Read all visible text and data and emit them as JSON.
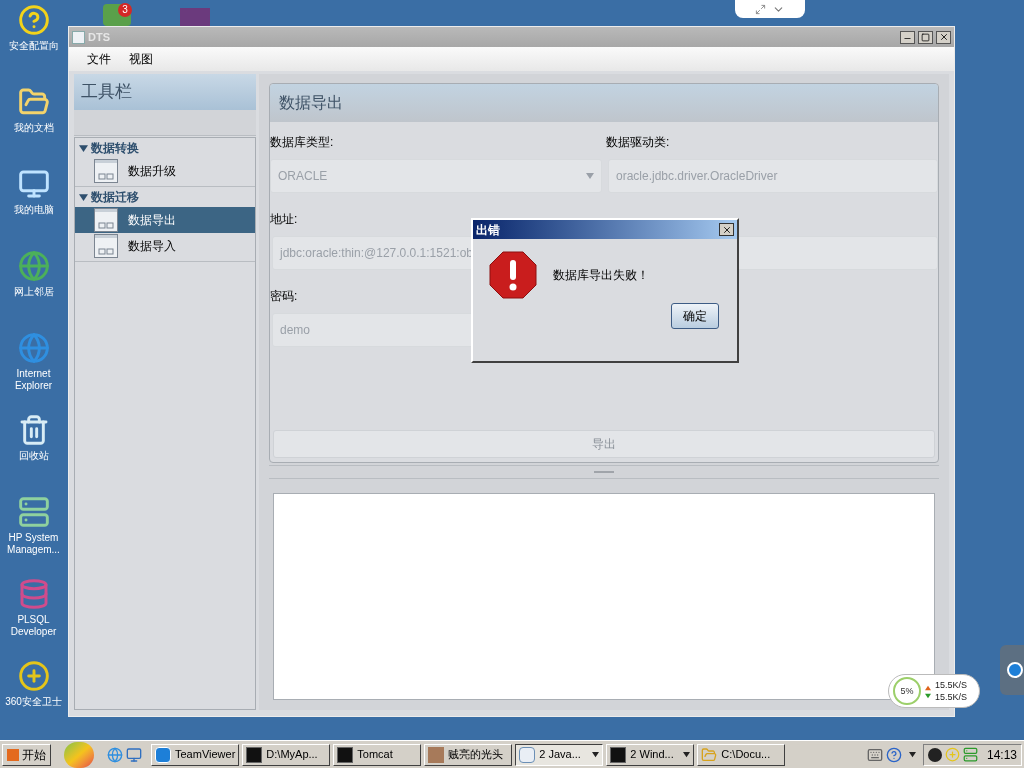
{
  "desktop_icons": [
    {
      "label": "安全配置向",
      "kind": "help"
    },
    {
      "label": "我的文档",
      "kind": "folder"
    },
    {
      "label": "我的电脑",
      "kind": "computer"
    },
    {
      "label": "网上邻居",
      "kind": "network"
    },
    {
      "label": "Internet Explorer",
      "kind": "browser"
    },
    {
      "label": "回收站",
      "kind": "recycle"
    },
    {
      "label": "HP System Managem...",
      "kind": "server"
    },
    {
      "label": "PLSQL Developer",
      "kind": "database"
    },
    {
      "label": "360安全卫士",
      "kind": "shield"
    }
  ],
  "top_icons": {
    "badge": "3"
  },
  "window": {
    "title": "DTS",
    "menu": [
      "文件",
      "视图"
    ]
  },
  "sidebar": {
    "title": "工具栏",
    "groups": [
      {
        "label": "数据转换",
        "expanded": true,
        "children": [
          {
            "label": "数据升级",
            "selected": false
          }
        ]
      },
      {
        "label": "数据迁移",
        "expanded": true,
        "children": [
          {
            "label": "数据导出",
            "selected": true
          },
          {
            "label": "数据导入",
            "selected": false
          }
        ]
      }
    ]
  },
  "panel": {
    "title": "数据导出",
    "fields": [
      {
        "label": "数据库类型:",
        "kind": "select",
        "value": "ORACLE"
      },
      {
        "label": "数据驱动类:",
        "kind": "text",
        "value": "oracle.jdbc.driver.OracleDriver"
      },
      {
        "label": "地址:",
        "kind": "text",
        "value": "jdbc:oracle:thin:@127.0.0.1:1521:ob"
      },
      {
        "kind": "text"
      },
      {
        "label": "密码:",
        "kind": "text",
        "value": "demo"
      }
    ],
    "button": "导出"
  },
  "dialog": {
    "title": "出错",
    "message": "数据库导出失败！",
    "button": "确定"
  },
  "net_monitor": {
    "cpu": "5%",
    "up": "15.5K/S",
    "down": "15.5K/S"
  },
  "taskbar": {
    "start": "开始",
    "tasks": [
      {
        "label": "TeamViewer",
        "kind": "teamviewer",
        "grouped": false,
        "selected": false
      },
      {
        "label": "D:\\MyAp...",
        "kind": "console",
        "grouped": false,
        "selected": false
      },
      {
        "label": "Tomcat",
        "kind": "console",
        "grouped": false,
        "selected": false
      },
      {
        "label": "贼亮的光头",
        "kind": "photo",
        "grouped": false,
        "selected": false
      },
      {
        "label": "2 Java...",
        "kind": "java",
        "grouped": true,
        "selected": true
      },
      {
        "label": "2 Wind...",
        "kind": "console",
        "grouped": true,
        "selected": false
      },
      {
        "label": "C:\\Docu...",
        "kind": "folder",
        "grouped": false,
        "selected": false
      }
    ],
    "clock": "14:13"
  }
}
